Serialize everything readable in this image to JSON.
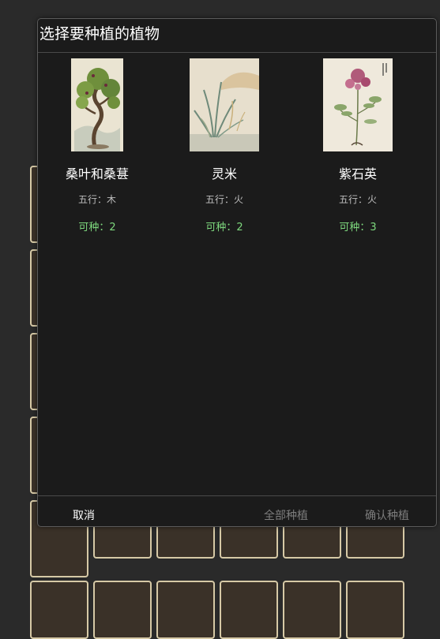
{
  "dialog": {
    "title": "选择要种植的植物",
    "plants": [
      {
        "name": "桑叶和桑葚",
        "element": "五行：木",
        "count": "可种：2",
        "icon": "mulberry-tree-painting"
      },
      {
        "name": "灵米",
        "element": "五行：火",
        "count": "可种：2",
        "icon": "spirit-rice-painting"
      },
      {
        "name": "紫石英",
        "element": "五行：火",
        "count": "可种：3",
        "icon": "purple-flower-painting"
      }
    ],
    "buttons": {
      "cancel": "取消",
      "plant_all": "全部种植",
      "confirm": "确认种植"
    }
  },
  "colors": {
    "dialog_bg": "#1b1b1b",
    "count_text": "#7ed97e",
    "disabled_text": "#7d7d7d",
    "cell_border": "#d6c9a6"
  }
}
